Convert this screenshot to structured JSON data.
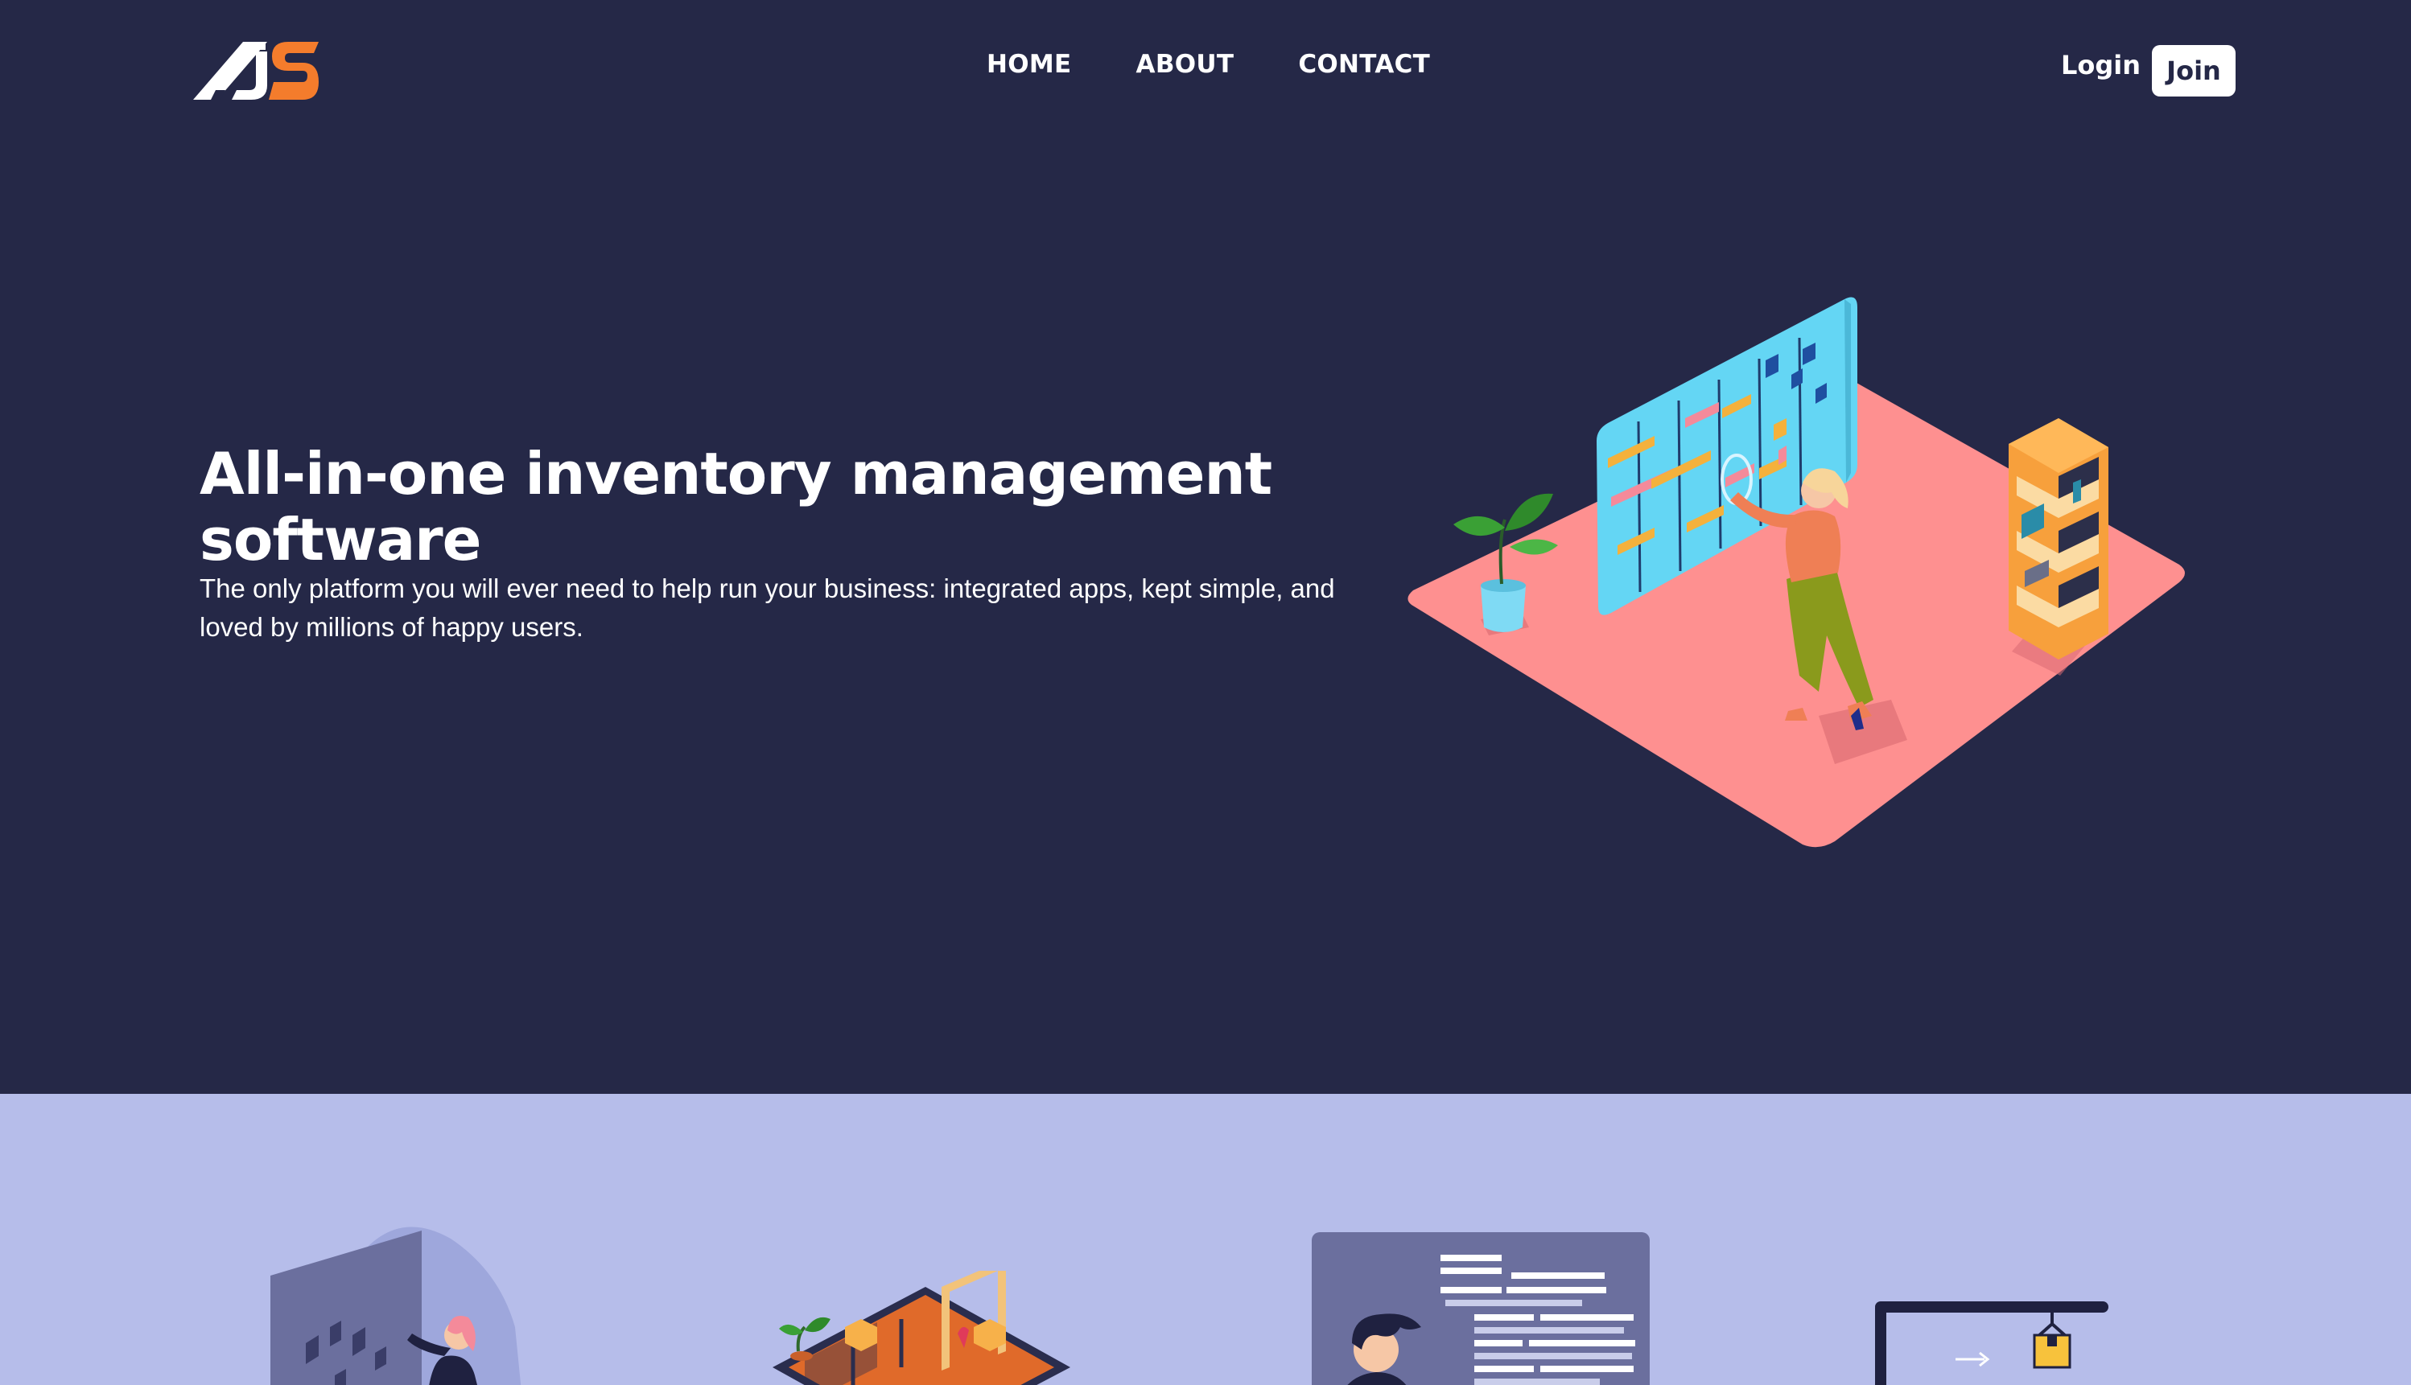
{
  "brand": {
    "logo_alt": "AJS logo",
    "logo_text": "AJS",
    "accent_color": "#f47c2c"
  },
  "nav": {
    "links": [
      {
        "label": "HOME"
      },
      {
        "label": "ABOUT"
      },
      {
        "label": "CONTACT"
      }
    ],
    "login_label": "Login",
    "join_label": "Join"
  },
  "hero": {
    "title": "All-in-one inventory management software",
    "subtitle": "The only platform you will ever need to help run your business: integrated apps, kept simple, and loved by millions of happy users.",
    "background": "#252847",
    "illustration": "woman-organizing-board-illustration"
  },
  "features": {
    "background": "#b6bdea",
    "illustrations": [
      "woman-presenting-board-illustration",
      "warehouse-isometric-illustration",
      "man-with-document-illustration",
      "crane-moving-box-illustration"
    ]
  },
  "colors": {
    "hero_bg": "#252847",
    "features_bg": "#b6bdea",
    "floor_pink": "#fe9090",
    "board_blue": "#64d6f4",
    "shelf_orange": "#f7a03c",
    "plant_green": "#3aa035"
  }
}
